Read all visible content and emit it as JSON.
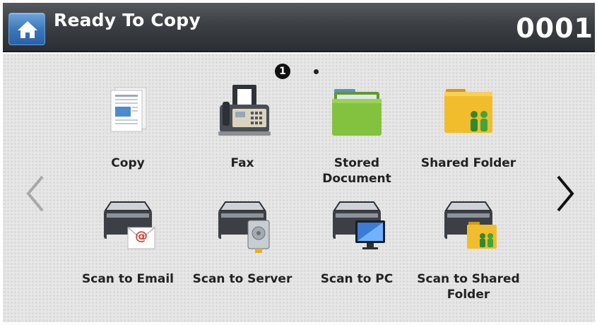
{
  "header": {
    "title": "Ready To Copy",
    "counter": "0001",
    "home_icon": "home-icon"
  },
  "pager": {
    "current_page": "1"
  },
  "apps": [
    {
      "label": "Copy",
      "icon": "copy-icon"
    },
    {
      "label": "Fax",
      "icon": "fax-icon"
    },
    {
      "label": "Stored\nDocument",
      "icon": "stored-document-icon"
    },
    {
      "label": "Shared Folder",
      "icon": "shared-folder-icon"
    },
    {
      "label": "Scan to Email",
      "icon": "scan-to-email-icon"
    },
    {
      "label": "Scan to Server",
      "icon": "scan-to-server-icon"
    },
    {
      "label": "Scan to PC",
      "icon": "scan-to-pc-icon"
    },
    {
      "label": "Scan to Shared\nFolder",
      "icon": "scan-to-shared-folder-icon"
    }
  ],
  "colors": {
    "header_dark": "#2b2e32",
    "home_blue": "#3c78bd",
    "folder_green": "#7cb83a",
    "folder_yellow": "#e8b020"
  }
}
